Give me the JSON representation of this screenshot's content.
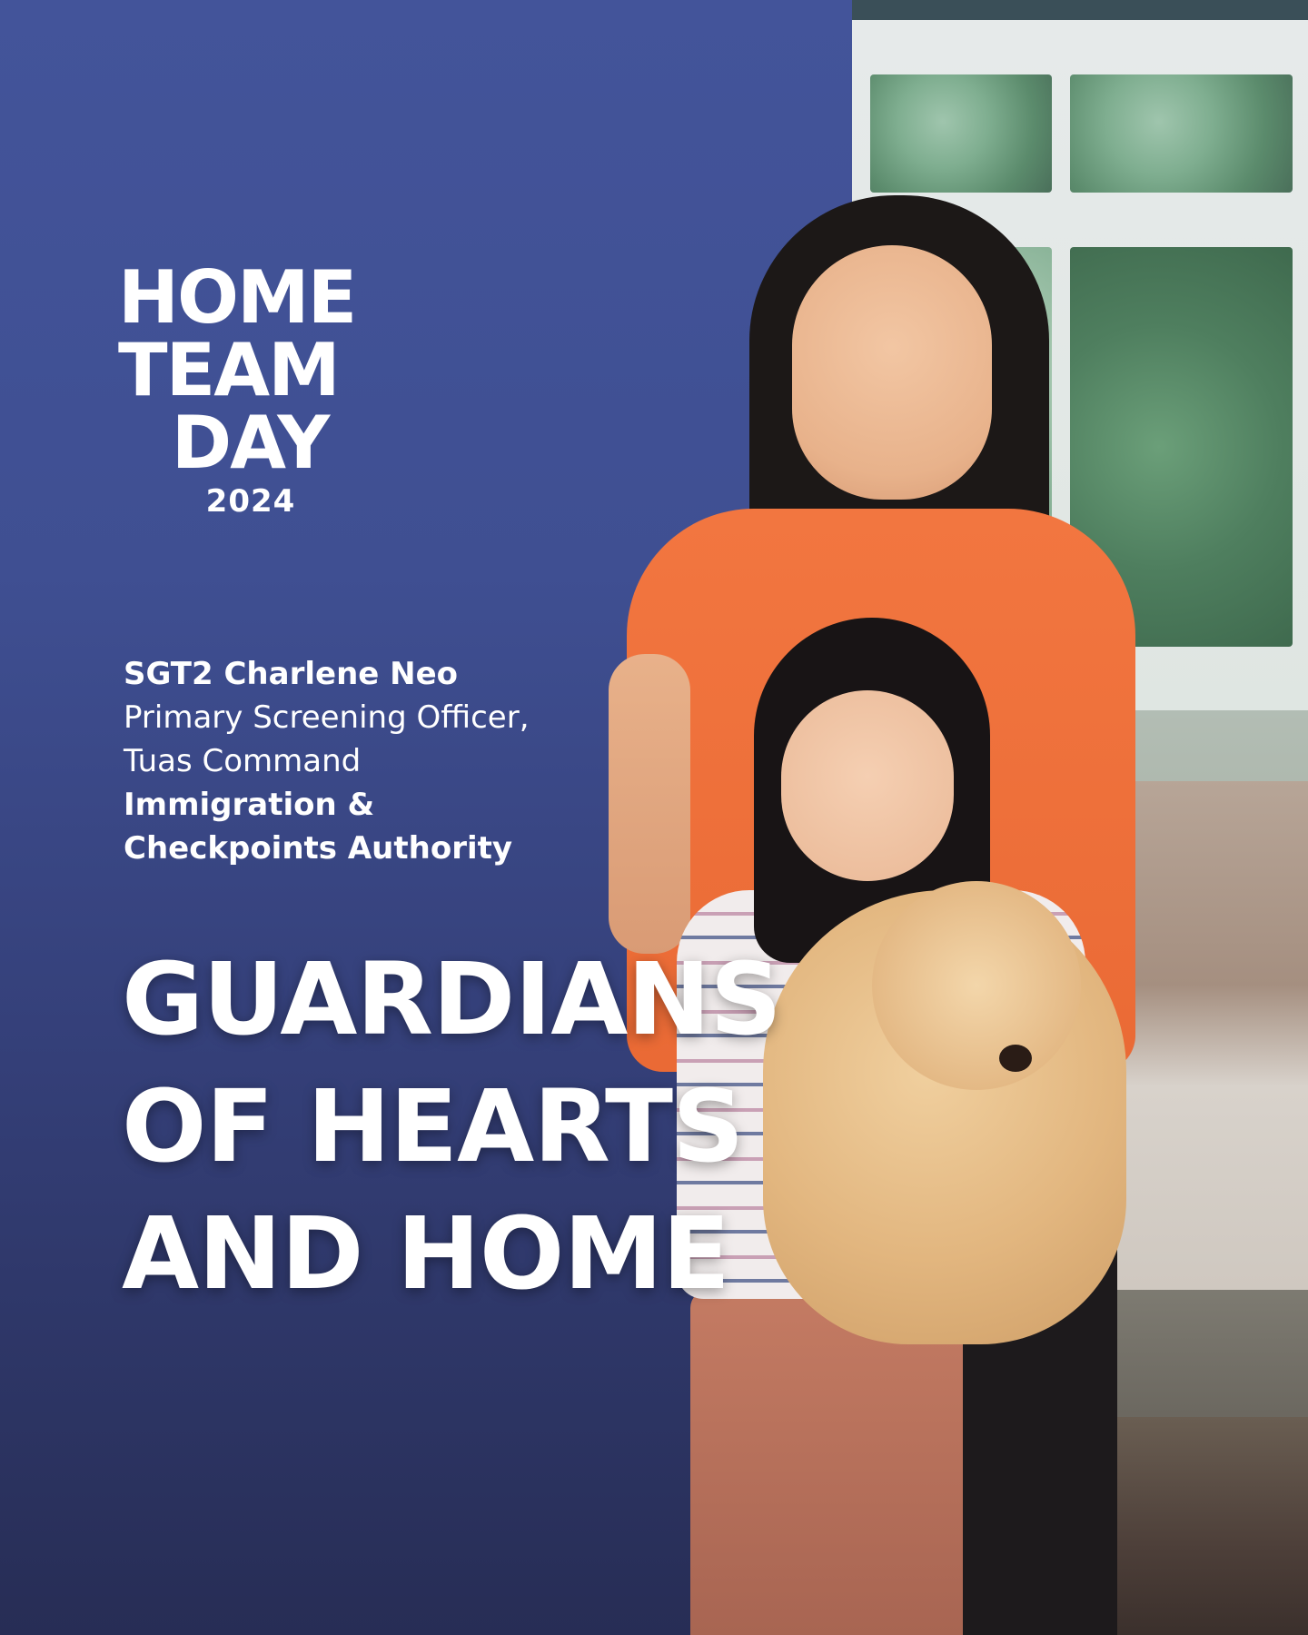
{
  "logo": {
    "line1": "HOME",
    "line2": "TEAM",
    "line3": "DAY",
    "year": "2024"
  },
  "credit": {
    "name": "SGT2 Charlene Neo",
    "role_line1": "Primary Screening Officer,",
    "role_line2": "Tuas Command",
    "org_line1": "Immigration &",
    "org_line2": "Checkpoints Authority"
  },
  "headline": {
    "line1": "GUARDIANS",
    "line2": "OF HEARTS",
    "line3": "AND HOME"
  },
  "colors": {
    "panel_navy": "#43549a",
    "text_white": "#ffffff",
    "shirt_orange": "#f27640"
  }
}
